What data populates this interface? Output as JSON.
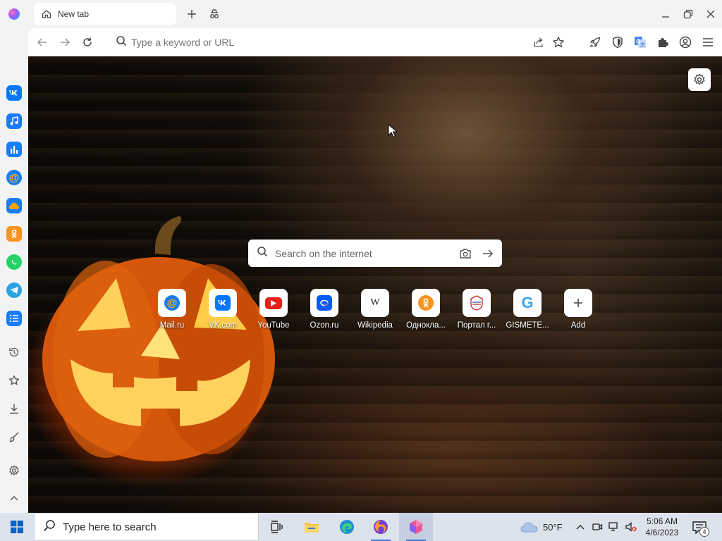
{
  "tab": {
    "label": "New tab"
  },
  "addressbar": {
    "placeholder": "Type a keyword or URL"
  },
  "search": {
    "placeholder": "Search on the internet"
  },
  "tiles": [
    {
      "label": "Mail.ru"
    },
    {
      "label": "VK.com"
    },
    {
      "label": "YouTube"
    },
    {
      "label": "Ozon.ru"
    },
    {
      "label": "Wikipedia"
    },
    {
      "label": "Одноклa..."
    },
    {
      "label": "Портал г..."
    },
    {
      "label": "GISMETE..."
    },
    {
      "label": "Add"
    }
  ],
  "sidebar_apps": [
    {
      "icon": "vk-icon",
      "color": "#0077ff"
    },
    {
      "icon": "music-icon",
      "color": "#1a7cf5"
    },
    {
      "icon": "chart-icon",
      "color": "#1a7cf5"
    },
    {
      "icon": "mail-at-icon",
      "color": "#1a7cf5"
    },
    {
      "icon": "cloud-icon",
      "color": "#1a7cf5"
    },
    {
      "icon": "odnoklassniki-icon",
      "color": "#f7931e"
    },
    {
      "icon": "whatsapp-icon",
      "color": "#25d366"
    },
    {
      "icon": "telegram-icon",
      "color": "#2aa3e0"
    },
    {
      "icon": "list-icon",
      "color": "#1a7cf5"
    }
  ],
  "taskbar": {
    "search_placeholder": "Type here to search",
    "weather": "50°F",
    "time": "5:06 AM",
    "date": "4/6/2023",
    "notifications": "4"
  }
}
